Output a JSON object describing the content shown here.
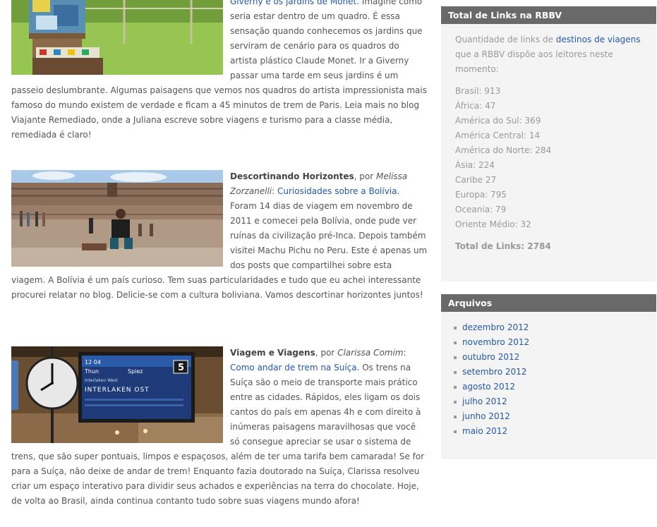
{
  "posts": [
    {
      "link_top": "Giverny e os jardins de Monet",
      "text_top": ". Imagine como seria estar dentro de um quadro. É essa sensação quando conhecemos os jardins que serviram de cenário para os quadros do artista plástico Claude Monet. Ir a Giverny passar uma tarde em seus jardins é um passeio deslumbrante. Algumas paisagens que vemos nos quadros do artista impressionista mais famoso do mundo existem de verdade e ficam a 45 minutos de trem de Paris. Leia mais no blog Viajante Remediado, onde a Juliana escreve sobre viagens e turismo para a classe média, remediada é claro!"
    },
    {
      "blog_name": "Descortinando Horizontes",
      "por": ", por ",
      "author": "Melissa Zorzanelli",
      "sep": ": ",
      "post_link": "Curiosidades sobre a Bolívia",
      "text": ". Foram 14 dias de viagem em novembro de 2011 e comecei pela Bolívia, onde pude ver ruínas da civilização pré-Inca. Depois também visitei Machu Pichu no Peru. Este é apenas um dos posts que compartilhei sobre esta viagem. A Bolívia é um país curioso. Tem suas particularidades e tudo que eu achei interessante procurei relatar no blog. Delicie-se com a cultura boliviana. Vamos descortinar horizontes juntos!"
    },
    {
      "blog_name": "Viagem e Viagens",
      "por": ", por ",
      "author": "Clarissa Comim",
      "sep": ": ",
      "post_link": "Como andar de trem na Suíça",
      "text": ". Os trens na Suíça são o meio de transporte mais prático entre as cidades. Rápidos, eles ligam os dois cantos do país em apenas 4h e com direito à inúmeras paisagens maravilhosas que você só consegue apreciar se usar o sistema de trens, que são super pontuais, limpos e espaçosos, além de ter uma tarifa bem camarada! Se for para a Suíça, não deixe de andar de trem! Enquanto fazia doutorado na Suíça, Clarissa resolveu criar um espaço interativo para dividir seus achados e experiências na terra do chocolate. Hoje, de volta ao Brasil, ainda continua contanto tudo sobre suas viagens mundo afora!"
    }
  ],
  "train_sign": {
    "time": "12 04",
    "city1": "Thun",
    "city2": "Spiez",
    "train": "Interlaken West",
    "dest": "INTERLAKEN OST",
    "platform": "5"
  },
  "links_widget": {
    "title": "Total de Links na RBBV",
    "intro_before": "Quantidade de links de ",
    "intro_link": "destinos de viagens",
    "intro_after": " que a RBBV dispõe aos leitores neste momento:",
    "regions": [
      "Brasil: 913",
      "África: 47",
      "América do Sul: 369",
      "América Central: 14",
      "América do Norte: 284",
      "Ásia: 224",
      "Caribe 27",
      "Europa: 795",
      "Oceania: 79",
      "Oriente Médio: 32"
    ],
    "total": "Total de Links: 2784"
  },
  "archive_widget": {
    "title": "Arquivos",
    "months": [
      "dezembro 2012",
      "novembro 2012",
      "outubro 2012",
      "setembro 2012",
      "agosto 2012",
      "julho 2012",
      "junho 2012",
      "maio 2012"
    ]
  }
}
